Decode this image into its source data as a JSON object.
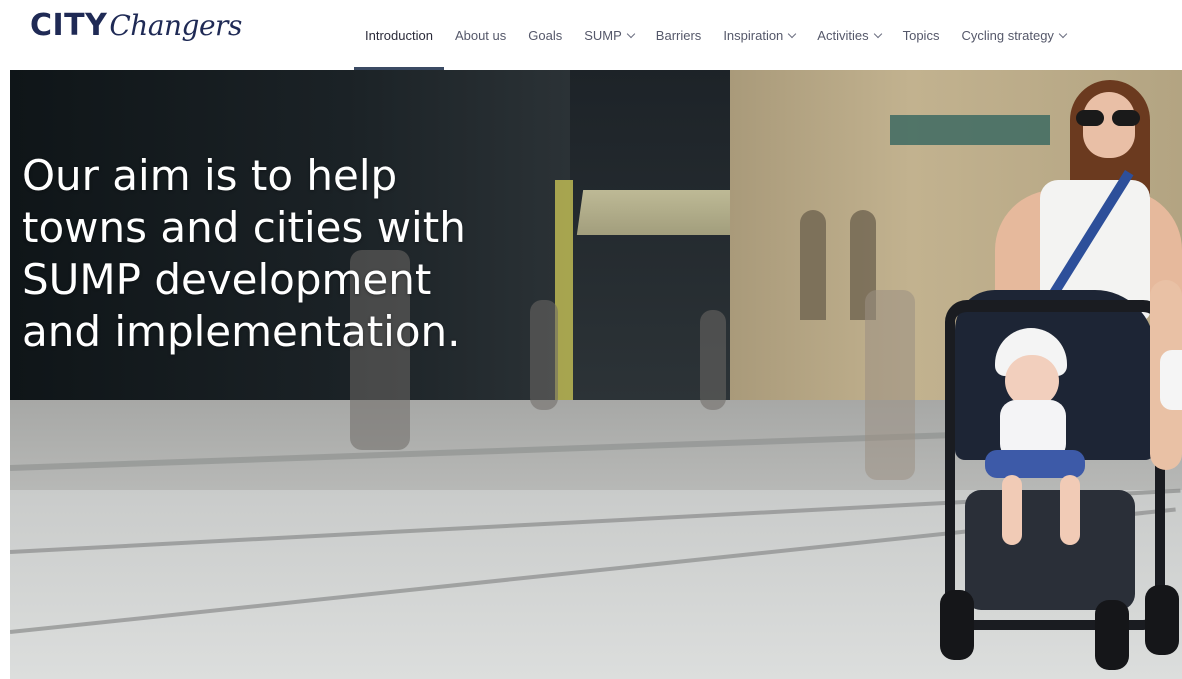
{
  "header": {
    "logo": {
      "city": "CITY",
      "changers": "Changers"
    },
    "nav": [
      {
        "label": "Introduction",
        "active": true,
        "dropdown": false
      },
      {
        "label": "About us",
        "active": false,
        "dropdown": false
      },
      {
        "label": "Goals",
        "active": false,
        "dropdown": false
      },
      {
        "label": "SUMP",
        "active": false,
        "dropdown": true
      },
      {
        "label": "Barriers",
        "active": false,
        "dropdown": false
      },
      {
        "label": "Inspiration",
        "active": false,
        "dropdown": true
      },
      {
        "label": "Activities",
        "active": false,
        "dropdown": true
      },
      {
        "label": "Topics",
        "active": false,
        "dropdown": false
      },
      {
        "label": "Cycling strategy",
        "active": false,
        "dropdown": true
      }
    ]
  },
  "hero": {
    "title_lines": [
      "Our aim is to help",
      "towns and cities with",
      "SUMP development",
      "and implementation."
    ]
  },
  "colors": {
    "brand_navy": "#1f2a55",
    "nav_text": "#55586a",
    "active_underline": "#3b4a63",
    "hero_text": "#ffffff"
  }
}
